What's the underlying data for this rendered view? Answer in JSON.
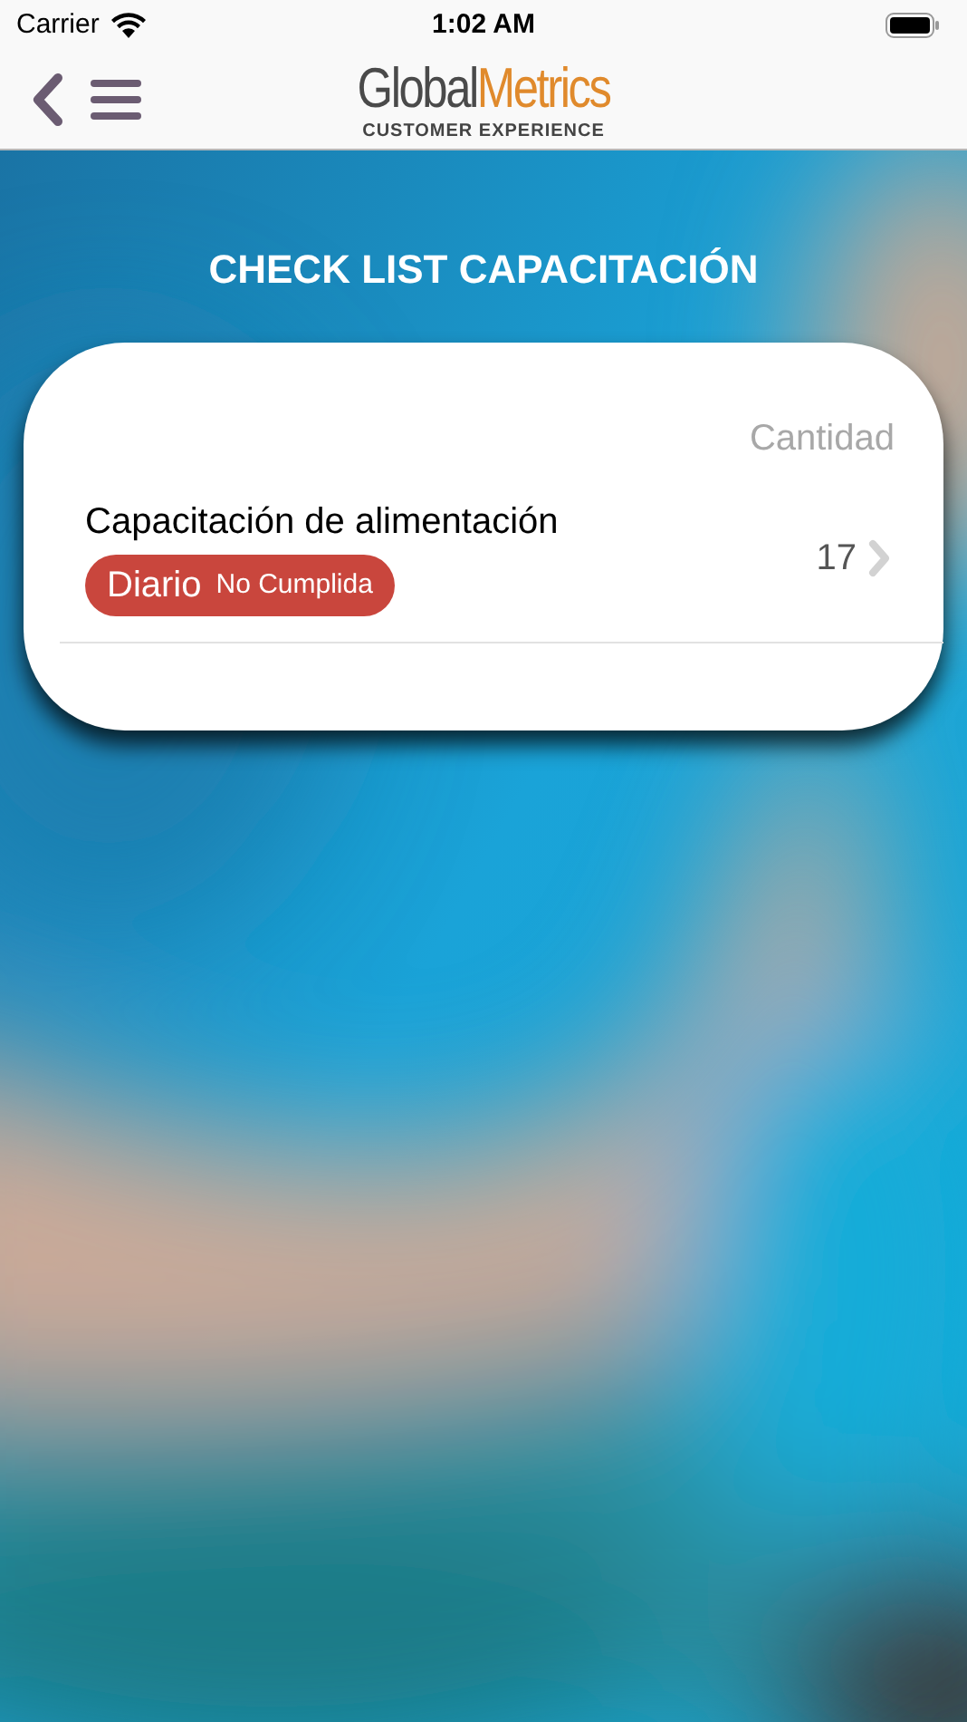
{
  "status_bar": {
    "carrier": "Carrier",
    "time": "1:02 AM"
  },
  "nav_bar": {
    "logo": {
      "part_1": "Global",
      "part_2": "Metrics",
      "tagline": "CUSTOMER EXPERIENCE"
    }
  },
  "title": "CHECK LIST CAPACITACIÓN",
  "list": {
    "column_header": "Cantidad",
    "items": [
      {
        "name": "Capacitación de alimentación",
        "frequency": "Diario",
        "status": "No Cumplida",
        "count": "17"
      }
    ]
  }
}
